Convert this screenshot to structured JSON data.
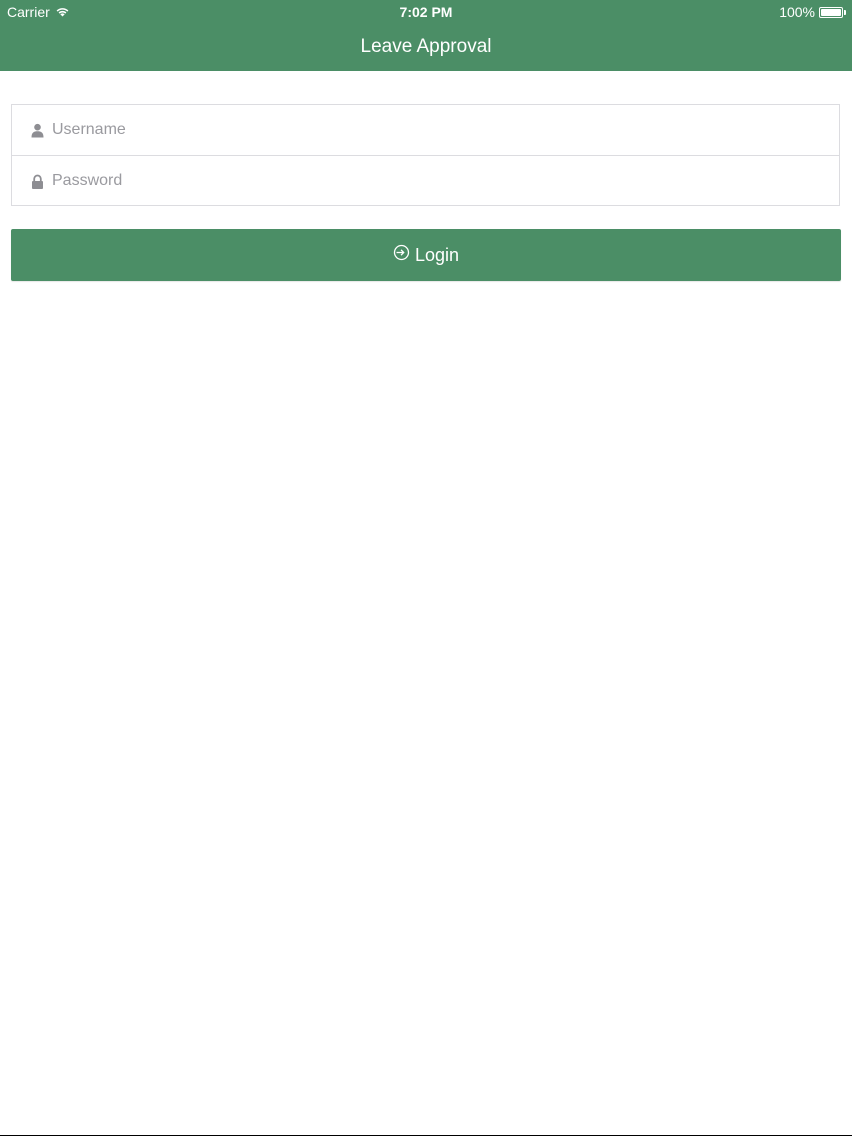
{
  "status_bar": {
    "carrier": "Carrier",
    "time": "7:02 PM",
    "battery": "100%"
  },
  "header": {
    "title": "Leave Approval"
  },
  "form": {
    "username_placeholder": "Username",
    "username_value": "",
    "password_placeholder": "Password",
    "password_value": ""
  },
  "login": {
    "label": "Login"
  },
  "icons": {
    "wifi": "wifi-icon",
    "battery": "battery-icon",
    "user": "user-icon",
    "lock": "lock-icon",
    "sign_in": "sign-in-icon"
  },
  "colors": {
    "primary": "#4b8e66",
    "placeholder": "#9a9a9f",
    "border": "#dcdce0"
  }
}
